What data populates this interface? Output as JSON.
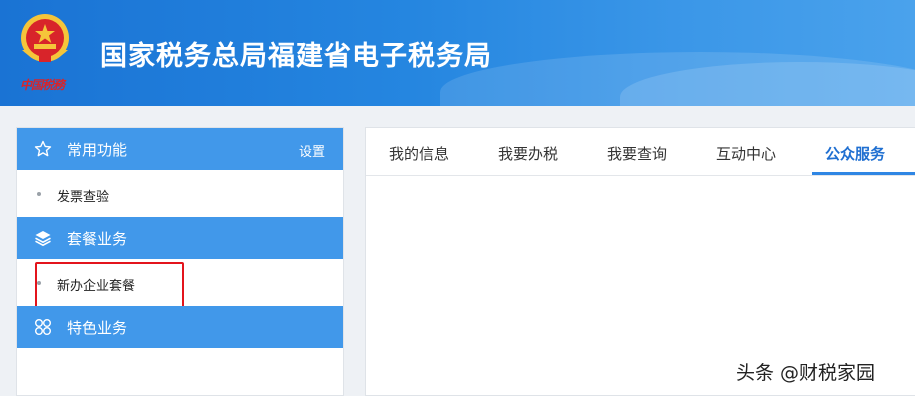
{
  "header": {
    "title": "国家税务总局福建省电子税务局",
    "emblem_text": "中国税務",
    "emblem_icon": "national-tax-emblem"
  },
  "sidebar": {
    "sections": [
      {
        "label": "常用功能",
        "icon": "star-icon",
        "action": "设置",
        "items": [
          "发票查验"
        ]
      },
      {
        "label": "套餐业务",
        "icon": "layers-icon",
        "items": [
          "新办企业套餐"
        ]
      },
      {
        "label": "特色业务",
        "icon": "grid-icon",
        "items": []
      }
    ]
  },
  "main": {
    "tabs": [
      "我的信息",
      "我要办税",
      "我要查询",
      "互动中心",
      "公众服务"
    ],
    "active_tab": "公众服务"
  },
  "watermark": "头条 @财税家园",
  "colors": {
    "header_blue": "#1a73d4",
    "section_blue": "#4198ea",
    "active_tab": "#1f6fd1",
    "highlight_red": "#e3141c"
  }
}
